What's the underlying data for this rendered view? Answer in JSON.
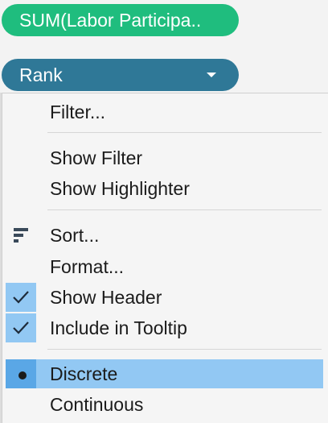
{
  "pills": {
    "measure_label": "SUM(Labor Participa..",
    "dimension_label": "Rank"
  },
  "menu": {
    "filter": "Filter...",
    "show_filter": "Show Filter",
    "show_highlighter": "Show Highlighter",
    "sort": "Sort...",
    "format": "Format...",
    "show_header": "Show Header",
    "include_in_tooltip": "Include in Tooltip",
    "discrete": "Discrete",
    "continuous": "Continuous"
  },
  "colors": {
    "measure_pill": "#1fbd7e",
    "dimension_pill": "#2f7897",
    "selection": "#92c8f3"
  }
}
